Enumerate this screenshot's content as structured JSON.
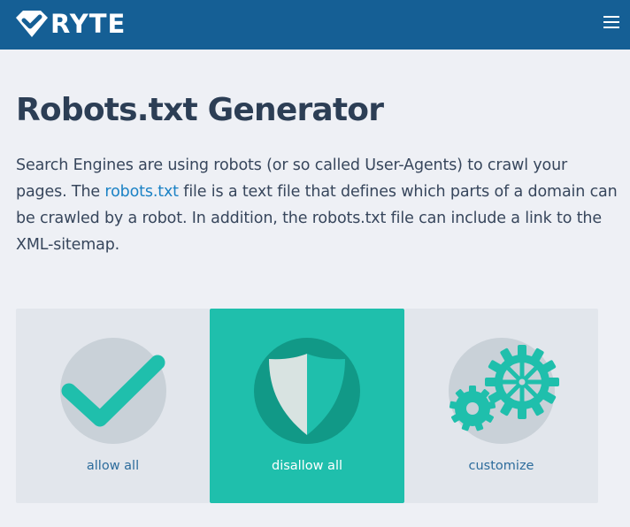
{
  "header": {
    "brand": "RYTE",
    "menu_icon": "hamburger-menu-icon"
  },
  "main": {
    "title": "Robots.txt Generator",
    "intro_part1": "Search Engines are using robots (or so called User-Agents) to crawl your pages. The ",
    "intro_link": "robots.txt",
    "intro_part2": " file is a text file that defines which parts of a domain can be crawled by a robot. In addition, the robots.txt file can include a link to the XML-sitemap."
  },
  "options": [
    {
      "label": "allow all",
      "icon": "checkmark-icon",
      "selected": false
    },
    {
      "label": "disallow all",
      "icon": "shield-icon",
      "selected": true
    },
    {
      "label": "customize",
      "icon": "gears-icon",
      "selected": false
    }
  ],
  "colors": {
    "header_bg": "#155f95",
    "accent": "#1fbfac",
    "accent_dark": "#119987",
    "page_bg": "#eef0f5",
    "card_bg": "#e2e6ec",
    "link": "#1b82c5"
  }
}
